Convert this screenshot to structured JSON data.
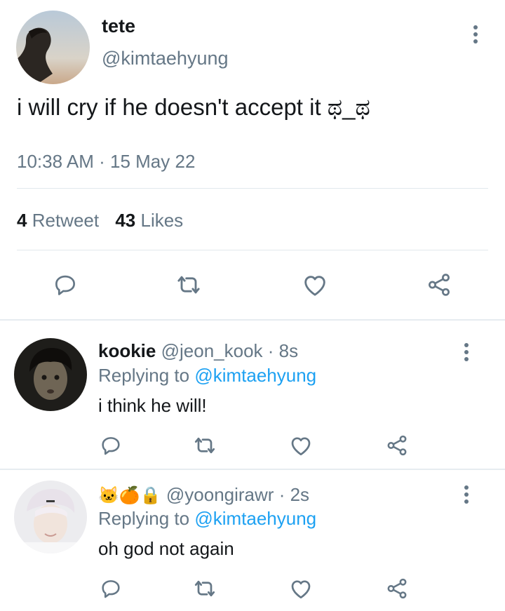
{
  "main_tweet": {
    "display_name": "tete",
    "handle": "@kimtaehyung",
    "text": "i will cry if he doesn't accept it ಥ_ಥ",
    "time": "10:38 AM",
    "separator": "·",
    "date": "15 May 22",
    "retweet_count": "4",
    "retweet_label": "Retweet",
    "like_count": "43",
    "like_label": "Likes"
  },
  "replies": [
    {
      "display_name": "kookie",
      "handle": "@jeon_kook",
      "time": "· 8s",
      "replying_prefix": "Replying to",
      "replying_to": "@kimtaehyung",
      "text": "i think he will!"
    },
    {
      "display_name": "🐱🍊🔒",
      "handle": "@yoongirawr",
      "time": "· 2s",
      "replying_prefix": "Replying to",
      "replying_to": "@kimtaehyung",
      "text": "oh god not again"
    }
  ],
  "icons": {
    "reply": "reply-icon",
    "retweet": "retweet-icon",
    "like": "heart-icon",
    "share": "share-icon",
    "more": "more-vertical-icon"
  },
  "colors": {
    "icon": "#657786",
    "link": "#1da1f2",
    "text": "#14171a",
    "divider": "#e1e8ed"
  }
}
